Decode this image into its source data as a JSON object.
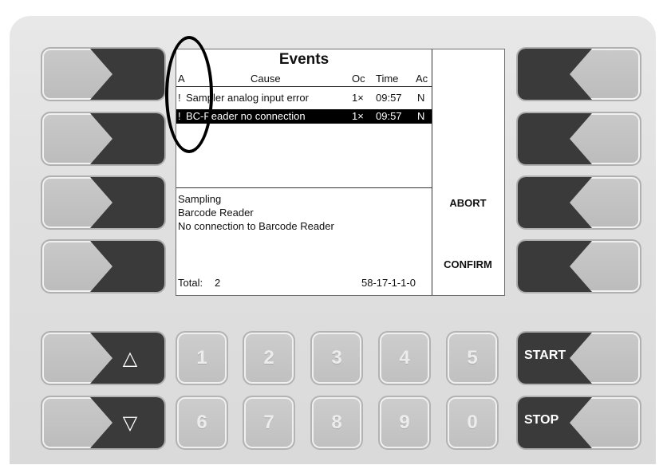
{
  "screen": {
    "title": "Events",
    "columns": [
      "A",
      "Cause",
      "Oc",
      "Time",
      "Ac"
    ],
    "events": [
      {
        "a": "!",
        "cause": "Sampler analog input error",
        "oc": "1×",
        "time": "09:57",
        "ac": "N"
      },
      {
        "a": "!",
        "cause": "BC-Reader no connection",
        "oc": "1×",
        "time": "09:57",
        "ac": "N"
      }
    ],
    "details": [
      "Sampling",
      "Barcode Reader",
      "No connection to Barcode Reader"
    ],
    "total_label": "Total:",
    "total_value": "2",
    "code": "58-17-1-1-0"
  },
  "softkeys_right": {
    "abort_label": "ABORT",
    "confirm_label": "CONFIRM"
  },
  "keypad": {
    "up_glyph": "△",
    "down_glyph": "▽",
    "row1": [
      "1",
      "2",
      "3",
      "4",
      "5"
    ],
    "row2": [
      "6",
      "7",
      "8",
      "9",
      "0"
    ],
    "start_label": "START",
    "stop_label": "STOP"
  },
  "colors": {
    "key_dark": "#3a3a3a",
    "key_light": "#c4c4c4",
    "selection": "#000000"
  }
}
